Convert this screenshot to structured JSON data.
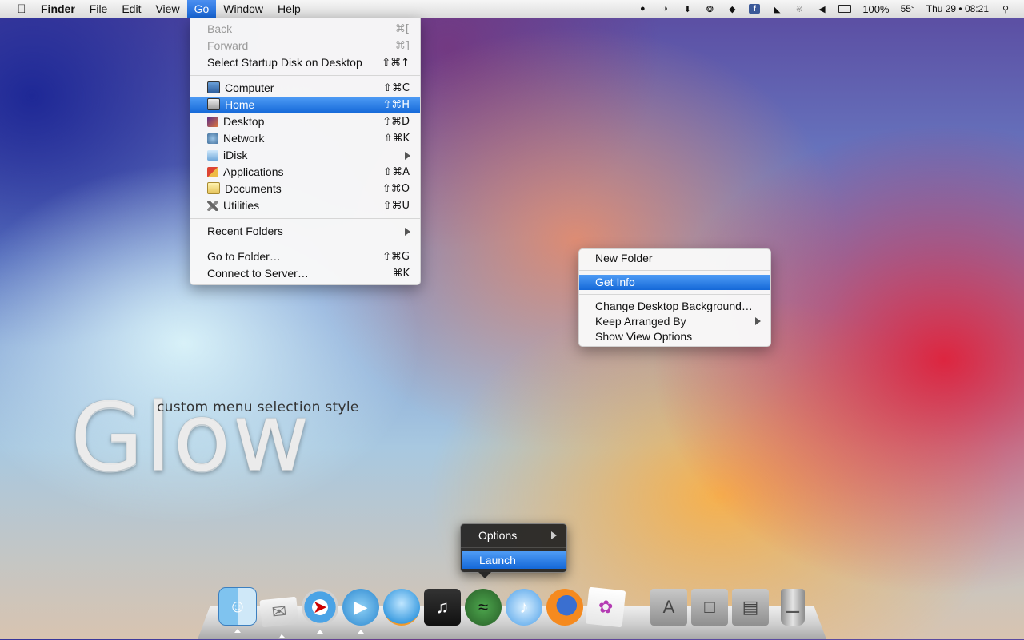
{
  "menubar": {
    "apple": "",
    "items": [
      "Finder",
      "File",
      "Edit",
      "View",
      "Go",
      "Window",
      "Help"
    ],
    "status": {
      "battery": "100%",
      "temperature": "55°",
      "datetime": "Thu 29 • 08:21"
    },
    "status_icons": [
      "chat-icon",
      "cloud-icon",
      "download-icon",
      "gauge-icon",
      "shield-icon",
      "facebook-icon",
      "wifi-icon",
      "bluetooth-icon",
      "volume-icon",
      "battery-icon",
      "spotlight-icon"
    ]
  },
  "go_menu": {
    "items": [
      {
        "label": "Back",
        "shortcut": "⌘[",
        "disabled": true
      },
      {
        "label": "Forward",
        "shortcut": "⌘]",
        "disabled": true
      },
      {
        "label": "Select Startup Disk on Desktop",
        "shortcut": "⇧⌘↑"
      },
      {
        "label": "Computer",
        "shortcut": "⇧⌘C",
        "icon": "computer-icon"
      },
      {
        "label": "Home",
        "shortcut": "⇧⌘H",
        "icon": "home-icon",
        "selected": true
      },
      {
        "label": "Desktop",
        "shortcut": "⇧⌘D",
        "icon": "desktop-icon"
      },
      {
        "label": "Network",
        "shortcut": "⇧⌘K",
        "icon": "network-icon"
      },
      {
        "label": "iDisk",
        "icon": "idisk-icon",
        "submenu": true
      },
      {
        "label": "Applications",
        "shortcut": "⇧⌘A",
        "icon": "applications-icon"
      },
      {
        "label": "Documents",
        "shortcut": "⇧⌘O",
        "icon": "documents-icon"
      },
      {
        "label": "Utilities",
        "shortcut": "⇧⌘U",
        "icon": "utilities-icon"
      },
      {
        "label": "Recent Folders",
        "submenu": true
      },
      {
        "label": "Go to Folder…",
        "shortcut": "⇧⌘G"
      },
      {
        "label": "Connect to Server…",
        "shortcut": "⌘K"
      }
    ]
  },
  "context_menu": {
    "items": [
      {
        "label": "New Folder"
      },
      {
        "label": "Get Info",
        "selected": true
      },
      {
        "label": "Change Desktop Background…"
      },
      {
        "label": "Keep Arranged By",
        "submenu": true
      },
      {
        "label": "Show View Options"
      }
    ]
  },
  "dock_popup": {
    "options": "Options",
    "launch": "Launch"
  },
  "desktop_text": {
    "title": "Glow",
    "subtitle": "custom menu selection style"
  },
  "dock": {
    "apps": [
      "finder-icon",
      "mail-icon",
      "safari-icon",
      "facetime-icon",
      "messages-icon",
      "music-app-icon",
      "spotify-icon",
      "itunes-icon",
      "firefox-icon",
      "preview-icon"
    ],
    "stacks": [
      "applications-stack-icon",
      "documents-stack-icon",
      "downloads-stack-icon",
      "trash-icon"
    ]
  },
  "colors": {
    "selection_top": "#4f9cf5",
    "selection_bottom": "#1468d8"
  }
}
